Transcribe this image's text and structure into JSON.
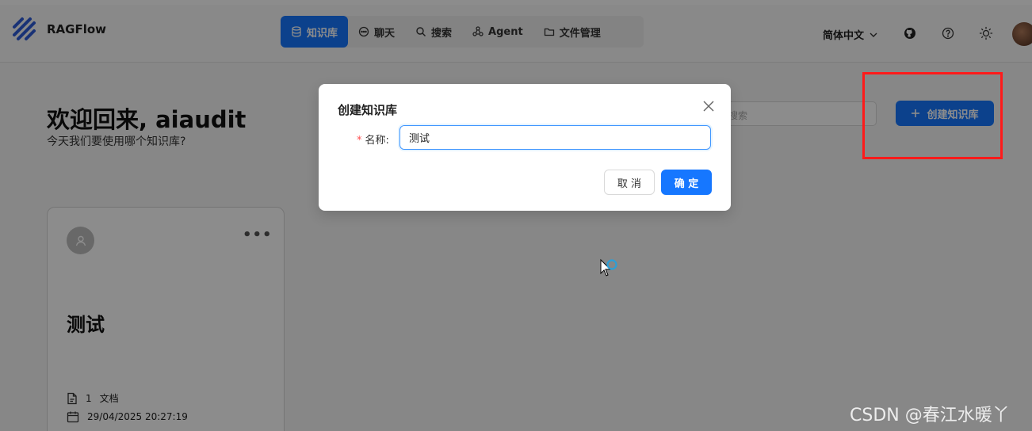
{
  "app": {
    "brand": "RAGFlow"
  },
  "nav": {
    "items": [
      {
        "label": "知识库",
        "icon": "database-icon",
        "active": true
      },
      {
        "label": "聊天",
        "icon": "chat-icon",
        "active": false
      },
      {
        "label": "搜索",
        "icon": "search-icon",
        "active": false
      },
      {
        "label": "Agent",
        "icon": "agent-icon",
        "active": false
      },
      {
        "label": "文件管理",
        "icon": "folder-icon",
        "active": false
      }
    ]
  },
  "header_right": {
    "language": "简体中文",
    "icons": [
      "github-icon",
      "help-icon",
      "theme-sun-icon",
      "user-avatar"
    ]
  },
  "page": {
    "welcome": "欢迎回来, aiaudit",
    "subtitle": "今天我们要使用哪个知识库?",
    "search_placeholder": "搜索",
    "create_button": "创建知识库"
  },
  "knowledge_card": {
    "title": "测试",
    "docs_count": "1",
    "docs_label": "文档",
    "date": "29/04/2025 20:27:19"
  },
  "modal": {
    "title": "创建知识库",
    "name_label": "名称",
    "name_value": "测试",
    "cancel": "取 消",
    "ok": "确 定"
  },
  "watermark": "CSDN @春江水暖丫",
  "colors": {
    "primary": "#1677ff",
    "highlight": "#ff1a1a",
    "required": "#ff4d4f"
  }
}
